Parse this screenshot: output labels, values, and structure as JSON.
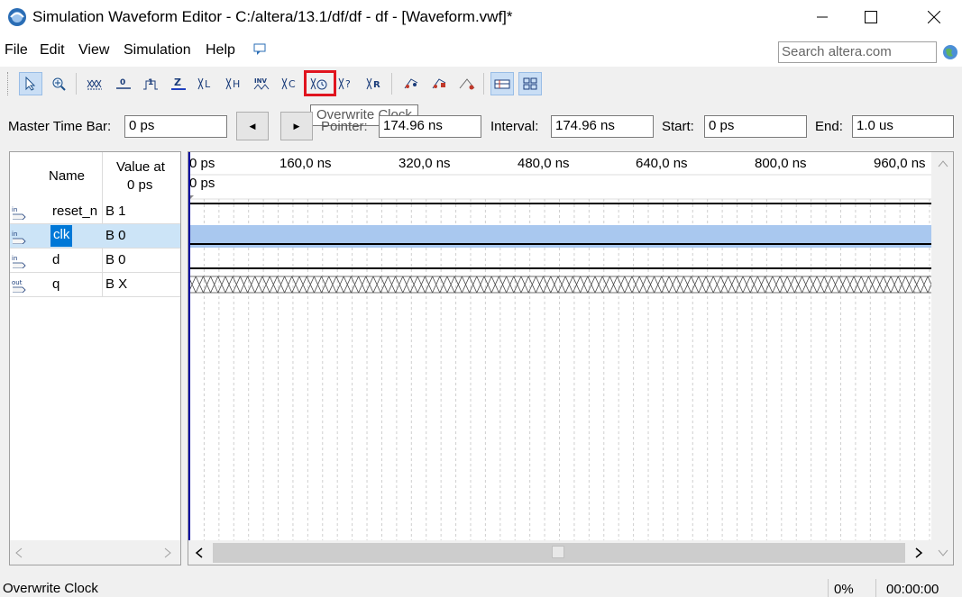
{
  "window": {
    "title": "Simulation Waveform Editor - C:/altera/13.1/df/df - df - [Waveform.vwf]*",
    "minimize": "—",
    "maximize": "☐",
    "close": "✕"
  },
  "menu": {
    "items": [
      "File",
      "Edit",
      "View",
      "Simulation",
      "Help"
    ],
    "search_placeholder": "Search altera.com"
  },
  "toolbar": {
    "tools": [
      {
        "name": "selection-tool",
        "glyph": "↖",
        "selected": true
      },
      {
        "name": "zoom-tool",
        "glyph": "⊕"
      },
      {
        "name": "forcing-unknown",
        "glyph": "X"
      },
      {
        "name": "forcing-low",
        "glyph": "0"
      },
      {
        "name": "forcing-high",
        "glyph": "1"
      },
      {
        "name": "high-impedance",
        "glyph": "Z"
      },
      {
        "name": "weak-low",
        "glyph": "L"
      },
      {
        "name": "weak-high",
        "glyph": "H"
      },
      {
        "name": "invert",
        "glyph": "INV"
      },
      {
        "name": "count-value",
        "glyph": "C"
      },
      {
        "name": "overwrite-clock",
        "glyph": "Ö"
      },
      {
        "name": "arbitrary-value",
        "glyph": "?"
      },
      {
        "name": "random-values",
        "glyph": "R"
      }
    ],
    "highlighted_tool": "overwrite-clock",
    "tooltip": "Overwrite Clock"
  },
  "timebar": {
    "master_label": "Master Time Bar:",
    "master_value": "0 ps",
    "pointer_label": "Pointer:",
    "pointer_value": "174.96 ns",
    "interval_label": "Interval:",
    "interval_value": "174.96 ns",
    "start_label": "Start:",
    "start_value": "0 ps",
    "end_label": "End:",
    "end_value": "1.0 us",
    "prev_glyph": "◀",
    "next_glyph": "▶"
  },
  "signals_header": {
    "name": "Name",
    "value_line1": "Value at",
    "value_line2": "0 ps"
  },
  "signals": [
    {
      "dir": "in",
      "name": "reset_n",
      "value": "B 1",
      "wave": "high"
    },
    {
      "dir": "in",
      "name": "clk",
      "value": "B 0",
      "wave": "low",
      "selected": true
    },
    {
      "dir": "in",
      "name": "d",
      "value": "B 0",
      "wave": "low"
    },
    {
      "dir": "out",
      "name": "q",
      "value": "B X",
      "wave": "unknown"
    }
  ],
  "timeline": {
    "ticks": [
      "0 ps",
      "160,0 ns",
      "320,0 ns",
      "480,0 ns",
      "640,0 ns",
      "800,0 ns",
      "960,0 ns"
    ],
    "cursor_label": "0 ps",
    "end_us": 1.0
  },
  "status": {
    "message": "Overwrite Clock",
    "progress": "0%",
    "elapsed": "00:00:00"
  },
  "colors": {
    "highlight": "#e0141e",
    "selection": "#0078d7",
    "selected_row": "#cce4f7",
    "selected_wave": "#a9c8ef"
  }
}
